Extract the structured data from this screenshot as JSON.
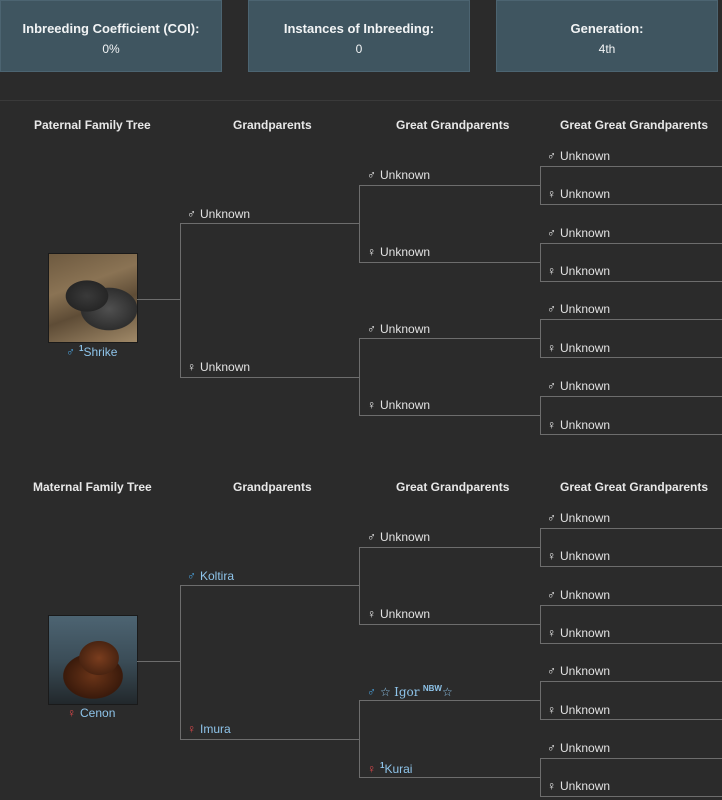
{
  "stats": [
    {
      "label": "Inbreeding Coefficient (COI):",
      "value": "0%"
    },
    {
      "label": "Instances of Inbreeding:",
      "value": "0"
    },
    {
      "label": "Generation:",
      "value": "4th"
    }
  ],
  "headers": {
    "paternal": "Paternal Family Tree",
    "maternal": "Maternal Family Tree",
    "grandparents": "Grandparents",
    "great": "Great Grandparents",
    "great_great": "Great Great Grandparents"
  },
  "symbols": {
    "male": "♂",
    "female": "♀",
    "star": "☆"
  },
  "paternal": {
    "subject": {
      "sup": "1",
      "name": "Shrike"
    },
    "grandparents": [
      "Unknown",
      "Unknown"
    ],
    "great": [
      "Unknown",
      "Unknown",
      "Unknown",
      "Unknown"
    ],
    "great_great": [
      "Unknown",
      "Unknown",
      "Unknown",
      "Unknown",
      "Unknown",
      "Unknown",
      "Unknown",
      "Unknown"
    ]
  },
  "maternal": {
    "subject": {
      "name": "Cenon"
    },
    "grandparents": [
      "Koltira",
      "Imura"
    ],
    "great": {
      "g1": "Unknown",
      "g2": "Unknown",
      "g3_name": "Igor",
      "g3_sup": "NBW",
      "g4_sup": "1",
      "g4_name": "Kurai"
    },
    "great_great": [
      "Unknown",
      "Unknown",
      "Unknown",
      "Unknown",
      "Unknown",
      "Unknown",
      "Unknown",
      "Unknown"
    ]
  },
  "colors": {
    "accent_link": "#8ec4ea",
    "male_blue": "#4aa3df",
    "female_red": "#e0484b",
    "stat_bg": "#3f5560",
    "page_bg": "#2b2b2b"
  }
}
